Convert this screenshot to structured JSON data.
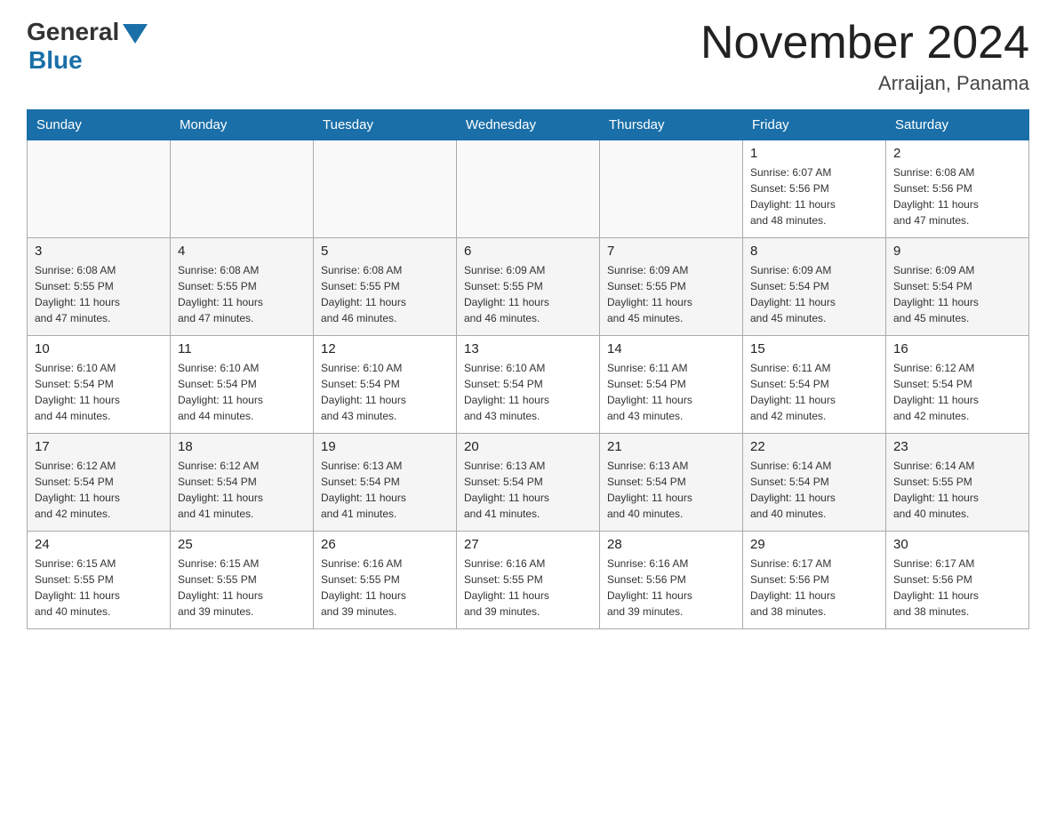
{
  "header": {
    "logo_general": "General",
    "logo_blue": "Blue",
    "month_title": "November 2024",
    "location": "Arraijan, Panama"
  },
  "days_of_week": [
    "Sunday",
    "Monday",
    "Tuesday",
    "Wednesday",
    "Thursday",
    "Friday",
    "Saturday"
  ],
  "weeks": [
    [
      {
        "day": "",
        "info": ""
      },
      {
        "day": "",
        "info": ""
      },
      {
        "day": "",
        "info": ""
      },
      {
        "day": "",
        "info": ""
      },
      {
        "day": "",
        "info": ""
      },
      {
        "day": "1",
        "info": "Sunrise: 6:07 AM\nSunset: 5:56 PM\nDaylight: 11 hours\nand 48 minutes."
      },
      {
        "day": "2",
        "info": "Sunrise: 6:08 AM\nSunset: 5:56 PM\nDaylight: 11 hours\nand 47 minutes."
      }
    ],
    [
      {
        "day": "3",
        "info": "Sunrise: 6:08 AM\nSunset: 5:55 PM\nDaylight: 11 hours\nand 47 minutes."
      },
      {
        "day": "4",
        "info": "Sunrise: 6:08 AM\nSunset: 5:55 PM\nDaylight: 11 hours\nand 47 minutes."
      },
      {
        "day": "5",
        "info": "Sunrise: 6:08 AM\nSunset: 5:55 PM\nDaylight: 11 hours\nand 46 minutes."
      },
      {
        "day": "6",
        "info": "Sunrise: 6:09 AM\nSunset: 5:55 PM\nDaylight: 11 hours\nand 46 minutes."
      },
      {
        "day": "7",
        "info": "Sunrise: 6:09 AM\nSunset: 5:55 PM\nDaylight: 11 hours\nand 45 minutes."
      },
      {
        "day": "8",
        "info": "Sunrise: 6:09 AM\nSunset: 5:54 PM\nDaylight: 11 hours\nand 45 minutes."
      },
      {
        "day": "9",
        "info": "Sunrise: 6:09 AM\nSunset: 5:54 PM\nDaylight: 11 hours\nand 45 minutes."
      }
    ],
    [
      {
        "day": "10",
        "info": "Sunrise: 6:10 AM\nSunset: 5:54 PM\nDaylight: 11 hours\nand 44 minutes."
      },
      {
        "day": "11",
        "info": "Sunrise: 6:10 AM\nSunset: 5:54 PM\nDaylight: 11 hours\nand 44 minutes."
      },
      {
        "day": "12",
        "info": "Sunrise: 6:10 AM\nSunset: 5:54 PM\nDaylight: 11 hours\nand 43 minutes."
      },
      {
        "day": "13",
        "info": "Sunrise: 6:10 AM\nSunset: 5:54 PM\nDaylight: 11 hours\nand 43 minutes."
      },
      {
        "day": "14",
        "info": "Sunrise: 6:11 AM\nSunset: 5:54 PM\nDaylight: 11 hours\nand 43 minutes."
      },
      {
        "day": "15",
        "info": "Sunrise: 6:11 AM\nSunset: 5:54 PM\nDaylight: 11 hours\nand 42 minutes."
      },
      {
        "day": "16",
        "info": "Sunrise: 6:12 AM\nSunset: 5:54 PM\nDaylight: 11 hours\nand 42 minutes."
      }
    ],
    [
      {
        "day": "17",
        "info": "Sunrise: 6:12 AM\nSunset: 5:54 PM\nDaylight: 11 hours\nand 42 minutes."
      },
      {
        "day": "18",
        "info": "Sunrise: 6:12 AM\nSunset: 5:54 PM\nDaylight: 11 hours\nand 41 minutes."
      },
      {
        "day": "19",
        "info": "Sunrise: 6:13 AM\nSunset: 5:54 PM\nDaylight: 11 hours\nand 41 minutes."
      },
      {
        "day": "20",
        "info": "Sunrise: 6:13 AM\nSunset: 5:54 PM\nDaylight: 11 hours\nand 41 minutes."
      },
      {
        "day": "21",
        "info": "Sunrise: 6:13 AM\nSunset: 5:54 PM\nDaylight: 11 hours\nand 40 minutes."
      },
      {
        "day": "22",
        "info": "Sunrise: 6:14 AM\nSunset: 5:54 PM\nDaylight: 11 hours\nand 40 minutes."
      },
      {
        "day": "23",
        "info": "Sunrise: 6:14 AM\nSunset: 5:55 PM\nDaylight: 11 hours\nand 40 minutes."
      }
    ],
    [
      {
        "day": "24",
        "info": "Sunrise: 6:15 AM\nSunset: 5:55 PM\nDaylight: 11 hours\nand 40 minutes."
      },
      {
        "day": "25",
        "info": "Sunrise: 6:15 AM\nSunset: 5:55 PM\nDaylight: 11 hours\nand 39 minutes."
      },
      {
        "day": "26",
        "info": "Sunrise: 6:16 AM\nSunset: 5:55 PM\nDaylight: 11 hours\nand 39 minutes."
      },
      {
        "day": "27",
        "info": "Sunrise: 6:16 AM\nSunset: 5:55 PM\nDaylight: 11 hours\nand 39 minutes."
      },
      {
        "day": "28",
        "info": "Sunrise: 6:16 AM\nSunset: 5:56 PM\nDaylight: 11 hours\nand 39 minutes."
      },
      {
        "day": "29",
        "info": "Sunrise: 6:17 AM\nSunset: 5:56 PM\nDaylight: 11 hours\nand 38 minutes."
      },
      {
        "day": "30",
        "info": "Sunrise: 6:17 AM\nSunset: 5:56 PM\nDaylight: 11 hours\nand 38 minutes."
      }
    ]
  ]
}
